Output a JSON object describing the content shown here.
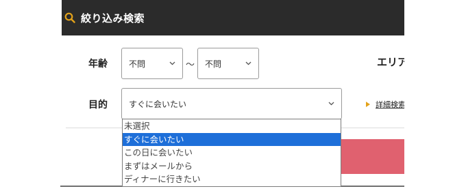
{
  "header": {
    "title": "絞り込み検索",
    "icon": "search-icon",
    "accent": "#e3a21a",
    "bg": "#2b2b2b"
  },
  "filters": {
    "age": {
      "label": "年齢",
      "min_value": "不問",
      "separator": "〜",
      "max_value": "不問"
    },
    "purpose": {
      "label": "目的",
      "value": "すぐに会いたい"
    }
  },
  "area": {
    "label": "エリア"
  },
  "detail_link": {
    "label": "詳細検索"
  },
  "dropdown": {
    "options": [
      {
        "label": "未選択",
        "selected": false
      },
      {
        "label": "すぐに会いたい",
        "selected": true
      },
      {
        "label": "この日に会いたい",
        "selected": false
      },
      {
        "label": "まずはメールから",
        "selected": false
      },
      {
        "label": "ディナーに行きたい",
        "selected": false
      }
    ],
    "highlight_color": "#1e6fd9"
  },
  "search_button": {
    "color": "#e0616f"
  }
}
